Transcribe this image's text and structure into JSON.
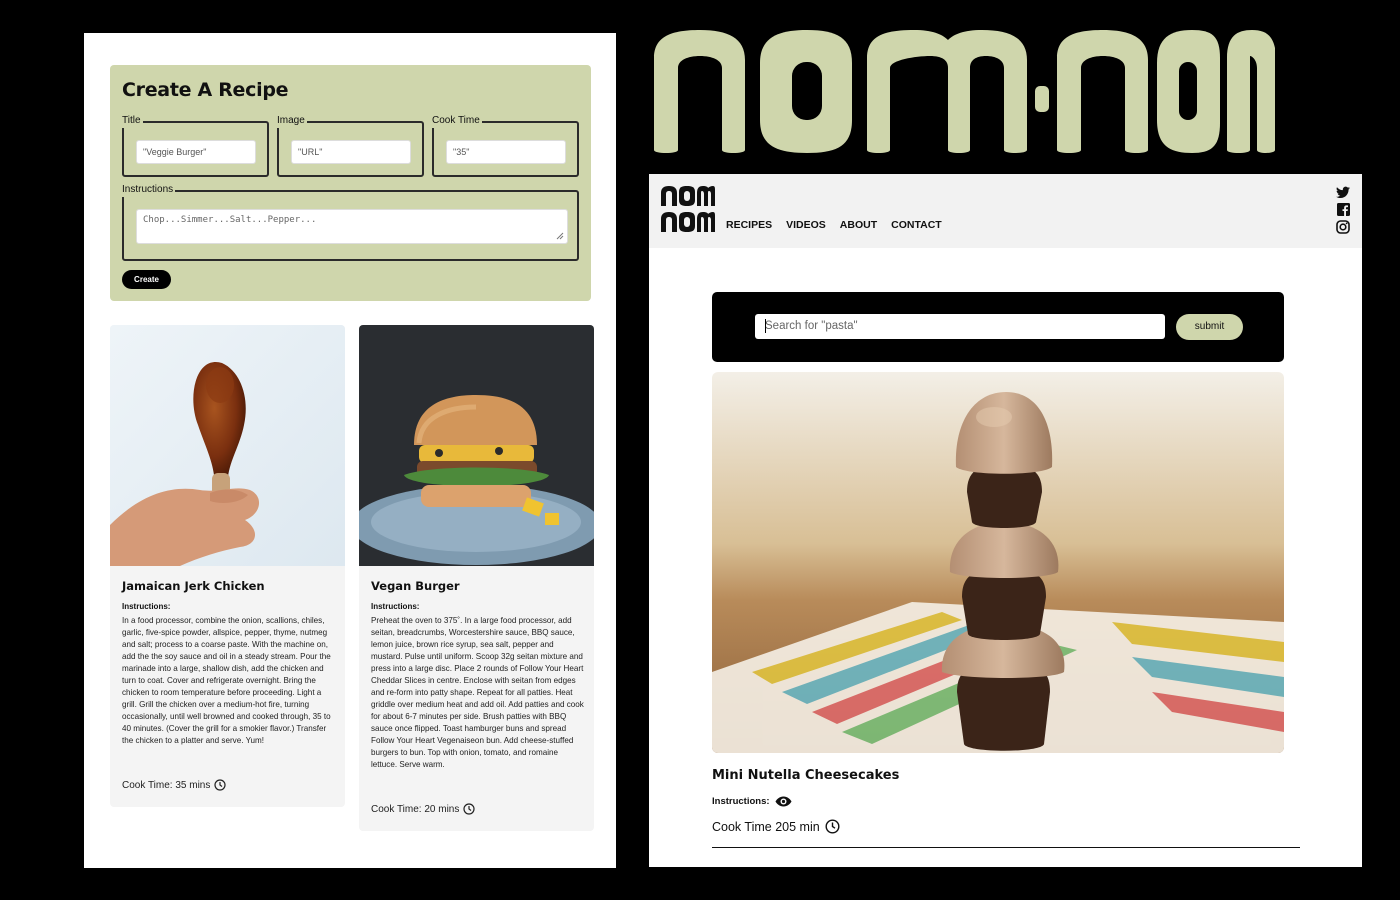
{
  "create_form": {
    "title": "Create A Recipe",
    "fields": {
      "title": {
        "legend": "Title",
        "placeholder": "\"Veggie Burger\""
      },
      "image": {
        "legend": "Image",
        "placeholder": "\"URL\""
      },
      "cook_time": {
        "legend": "Cook Time",
        "placeholder": "\"35\""
      },
      "instructions": {
        "legend": "Instructions",
        "placeholder": "Chop...Simmer...Salt...Pepper..."
      }
    },
    "create_button": "Create"
  },
  "recipes": [
    {
      "name": "Jamaican Jerk Chicken",
      "instructions_label": "Instructions:",
      "instructions": "In a food processor, combine the onion, scallions, chiles, garlic, five-spice powder, allspice, pepper, thyme, nutmeg and salt; process to a coarse paste. With the machine on, add the the soy sauce and oil in a steady stream. Pour the marinade into a large, shallow dish, add the chicken and turn to coat. Cover and refrigerate overnight. Bring the chicken to room temperature before proceeding. Light a grill. Grill the chicken over a medium-hot fire, turning occasionally, until well browned and cooked through, 35 to 40 minutes. (Cover the grill for a smokier flavor.) Transfer the chicken to a platter and serve. Yum!",
      "cook_time": "Cook Time: 35 mins"
    },
    {
      "name": "Vegan Burger",
      "instructions_label": "Instructions:",
      "instructions": "Preheat the oven to 375˚. In a large food processor, add seitan, breadcrumbs, Worcestershire sauce, BBQ sauce, lemon juice, brown rice syrup, sea salt, pepper and mustard. Pulse until uniform. Scoop 32g seitan mixture and press into a large disc. Place 2 rounds of Follow Your Heart Cheddar Slices in centre. Enclose with seitan from edges and re-form into patty shape. Repeat for all patties. Heat griddle over medium heat and add oil. Add patties and cook for about 6-7 minutes per side. Brush patties with BBQ sauce once flipped. Toast hamburger buns and spread Follow Your Heart Vegenaiseon bun. Add cheese-stuffed burgers to bun. Top with onion, tomato, and romaine lettuce. Serve warm.",
      "cook_time": "Cook Time: 20 mins"
    }
  ],
  "brand": {
    "logo_text": "nom·nom",
    "mini_logo_line1": "nom",
    "mini_logo_line2": "nom",
    "accent": "#cfd6ac"
  },
  "nav": {
    "links": [
      "RECIPES",
      "VIDEOS",
      "ABOUT",
      "CONTACT"
    ]
  },
  "social": [
    "twitter-icon",
    "facebook-icon",
    "instagram-icon"
  ],
  "search": {
    "placeholder": "Search for \"pasta\"",
    "submit": "submit"
  },
  "featured": {
    "name": "Mini Nutella Cheesecakes",
    "instructions_label": "Instructions:",
    "cook_time": "Cook Time 205 min"
  }
}
